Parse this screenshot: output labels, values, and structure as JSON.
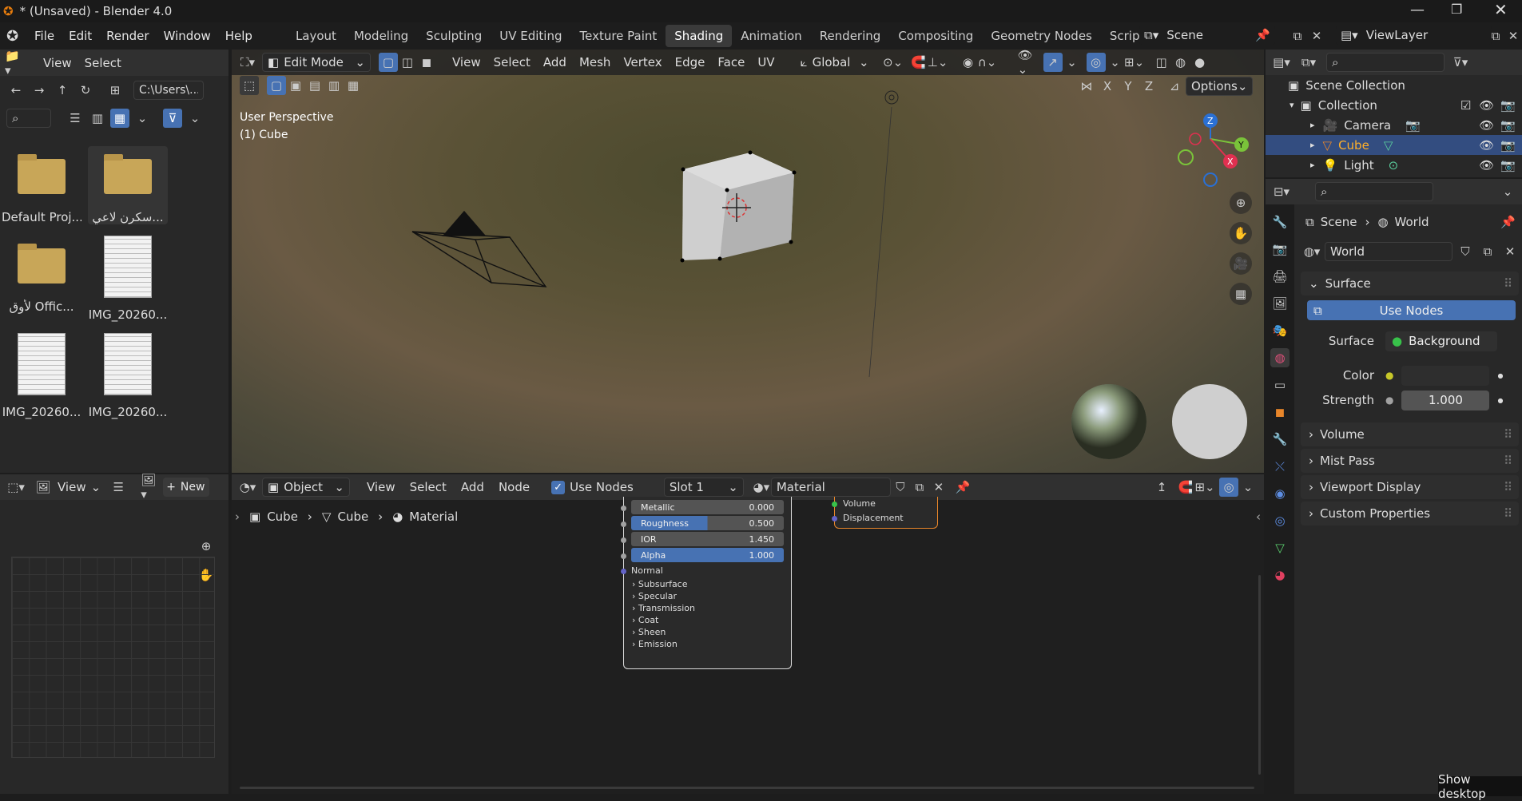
{
  "window": {
    "title": "* (Unsaved) - Blender 4.0"
  },
  "menu": [
    "File",
    "Edit",
    "Render",
    "Window",
    "Help"
  ],
  "workspaces": [
    "Layout",
    "Modeling",
    "Sculpting",
    "UV Editing",
    "Texture Paint",
    "Shading",
    "Animation",
    "Rendering",
    "Compositing",
    "Geometry Nodes",
    "Scripting"
  ],
  "active_workspace": "Shading",
  "scene": {
    "name": "Scene",
    "view_layer": "ViewLayer"
  },
  "file_browser": {
    "view": "View",
    "select": "Select",
    "path": "C:\\Users\\...",
    "items": [
      {
        "type": "folder",
        "name": "Default Proj..."
      },
      {
        "type": "folder",
        "name": "سكرن لاعي..."
      },
      {
        "type": "folder",
        "name": "لأوق Offic..."
      },
      {
        "type": "image",
        "name": "IMG_20260..."
      },
      {
        "type": "image",
        "name": "IMG_20260..."
      },
      {
        "type": "image",
        "name": "IMG_20260..."
      }
    ]
  },
  "viewport": {
    "mode": "Edit Mode",
    "menus": [
      "View",
      "Select",
      "Add",
      "Mesh",
      "Vertex",
      "Edge",
      "Face",
      "UV"
    ],
    "transform": "Global",
    "options": "Options",
    "axes": [
      "X",
      "Y",
      "Z"
    ],
    "overlay_line1": "User Perspective",
    "overlay_line2": "(1) Cube"
  },
  "outliner": {
    "root": "Scene Collection",
    "collection": "Collection",
    "items": [
      {
        "name": "Camera",
        "color": "#e0a060"
      },
      {
        "name": "Cube",
        "color": "#e0a060"
      },
      {
        "name": "Light",
        "color": "#e0a060"
      }
    ],
    "selected": "Cube"
  },
  "properties": {
    "breadcrumb_scene": "Scene",
    "breadcrumb_world": "World",
    "world_name": "World",
    "surface_title": "Surface",
    "use_nodes_label": "Use Nodes",
    "surface_label": "Surface",
    "surface_value": "Background",
    "color_label": "Color",
    "strength_label": "Strength",
    "strength_value": "1.000",
    "sections": [
      "Volume",
      "Mist Pass",
      "Viewport Display",
      "Custom Properties"
    ]
  },
  "uv_editor": {
    "view": "View",
    "new": "New"
  },
  "node_editor": {
    "object_mode": "Object",
    "menus": [
      "View",
      "Select",
      "Add",
      "Node"
    ],
    "use_nodes": "Use Nodes",
    "slot": "Slot 1",
    "material": "Material",
    "breadcrumb": [
      "Cube",
      "Cube",
      "Material"
    ],
    "bsdf_rows": [
      {
        "label": "Metallic",
        "value": "0.000",
        "fill": 0
      },
      {
        "label": "Roughness",
        "value": "0.500",
        "fill": 0.5
      },
      {
        "label": "IOR",
        "value": "1.450",
        "fill": 0
      },
      {
        "label": "Alpha",
        "value": "1.000",
        "fill": 1
      }
    ],
    "bsdf_normal": "Normal",
    "bsdf_panels": [
      "Subsurface",
      "Specular",
      "Transmission",
      "Coat",
      "Sheen",
      "Emission"
    ],
    "output_sockets": [
      "Volume",
      "Displacement"
    ]
  },
  "taskbar": {
    "show_desktop": "Show desktop"
  }
}
